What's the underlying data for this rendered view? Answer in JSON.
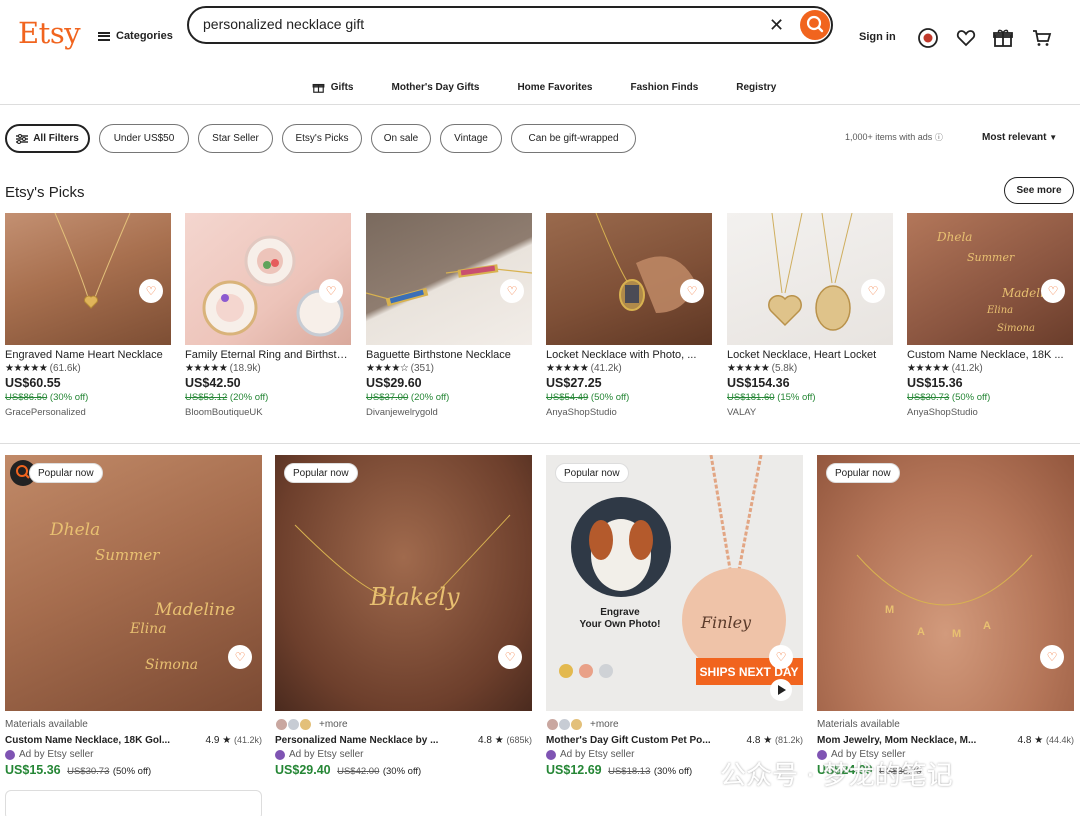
{
  "header": {
    "logo": "Etsy",
    "categories_label": "Categories",
    "search_value": "personalized necklace gift",
    "signin_label": "Sign in"
  },
  "nav": [
    {
      "label": "Gifts",
      "icon": "gift-icon"
    },
    {
      "label": "Mother's Day Gifts"
    },
    {
      "label": "Home Favorites"
    },
    {
      "label": "Fashion Finds"
    },
    {
      "label": "Registry"
    }
  ],
  "filters": {
    "chips": [
      "All Filters",
      "Under US$50",
      "Star Seller",
      "Etsy's Picks",
      "On sale",
      "Vintage",
      "Can be gift-wrapped"
    ],
    "results_text": "1,000+ items with ads",
    "sort_label": "Most relevant"
  },
  "picks": {
    "title": "Etsy's Picks",
    "see_more": "See more",
    "items": [
      {
        "name": "Engraved Name Heart Necklace",
        "stars": "★★★★★",
        "count": "(61.6k)",
        "price": "US$60.55",
        "orig": "US$86.50",
        "off": "(30% off)",
        "shop": "GracePersonalized"
      },
      {
        "name": "Family Eternal Ring and Birthstone",
        "stars": "★★★★★",
        "count": "(18.9k)",
        "price": "US$42.50",
        "orig": "US$53.12",
        "off": "(20% off)",
        "shop": "BloomBoutiqueUK"
      },
      {
        "name": "Baguette Birthstone Necklace",
        "stars": "★★★★☆",
        "count": "(351)",
        "price": "US$29.60",
        "orig": "US$37.00",
        "off": "(20% off)",
        "shop": "Divanjewelrygold"
      },
      {
        "name": "Locket Necklace with Photo, ...",
        "stars": "★★★★★",
        "count": "(41.2k)",
        "price": "US$27.25",
        "orig": "US$54.49",
        "off": "(50% off)",
        "shop": "AnyaShopStudio"
      },
      {
        "name": "Locket Necklace, Heart Locket",
        "stars": "★★★★★",
        "count": "(5.8k)",
        "price": "US$154.36",
        "orig": "US$181.60",
        "off": "(15% off)",
        "shop": "VALAY"
      },
      {
        "name": "Custom Name Necklace, 18K ...",
        "stars": "★★★★★",
        "count": "(41.2k)",
        "price": "US$15.36",
        "orig": "US$30.73",
        "off": "(50% off)",
        "shop": "AnyaShopStudio"
      }
    ]
  },
  "cards": [
    {
      "badge": "Popular now",
      "top_line": "Materials available",
      "name": "Custom Name Necklace, 18K Gol...",
      "rating": "4.9",
      "count": "(41.2k)",
      "ad": "Ad by Etsy seller",
      "price": "US$15.36",
      "orig": "US$30.73",
      "off": "(50% off)"
    },
    {
      "badge": "Popular now",
      "top_line": "+more",
      "name": "Personalized Name Necklace by ...",
      "rating": "4.8",
      "count": "(685k)",
      "ad": "Ad by Etsy seller",
      "price": "US$29.40",
      "orig": "US$42.00",
      "off": "(30% off)"
    },
    {
      "badge": "Popular now",
      "top_line": "+more",
      "name": "Mother's Day Gift Custom Pet Po...",
      "rating": "4.8",
      "count": "(81.2k)",
      "ad": "Ad by Etsy seller",
      "price": "US$12.69",
      "orig": "US$18.13",
      "off": "(30% off)",
      "promo_text_1": "Engrave",
      "promo_text_2": "Your Own Photo!",
      "pendant_text": "Finley",
      "ships_badge": "SHIPS NEXT DAY"
    },
    {
      "badge": "Popular now",
      "top_line": "Materials available",
      "name": "Mom Jewelry, Mom Necklace, M...",
      "rating": "4.8",
      "count": "(44.4k)",
      "ad": "Ad by Etsy seller",
      "price": "US$24.99",
      "orig": "US$35.70",
      "off": ""
    }
  ],
  "watermark": "公众号 · 梦龙的笔记",
  "colors": {
    "brand": "#f1641e",
    "sale": "#258635",
    "ad": "#7f54b3"
  }
}
